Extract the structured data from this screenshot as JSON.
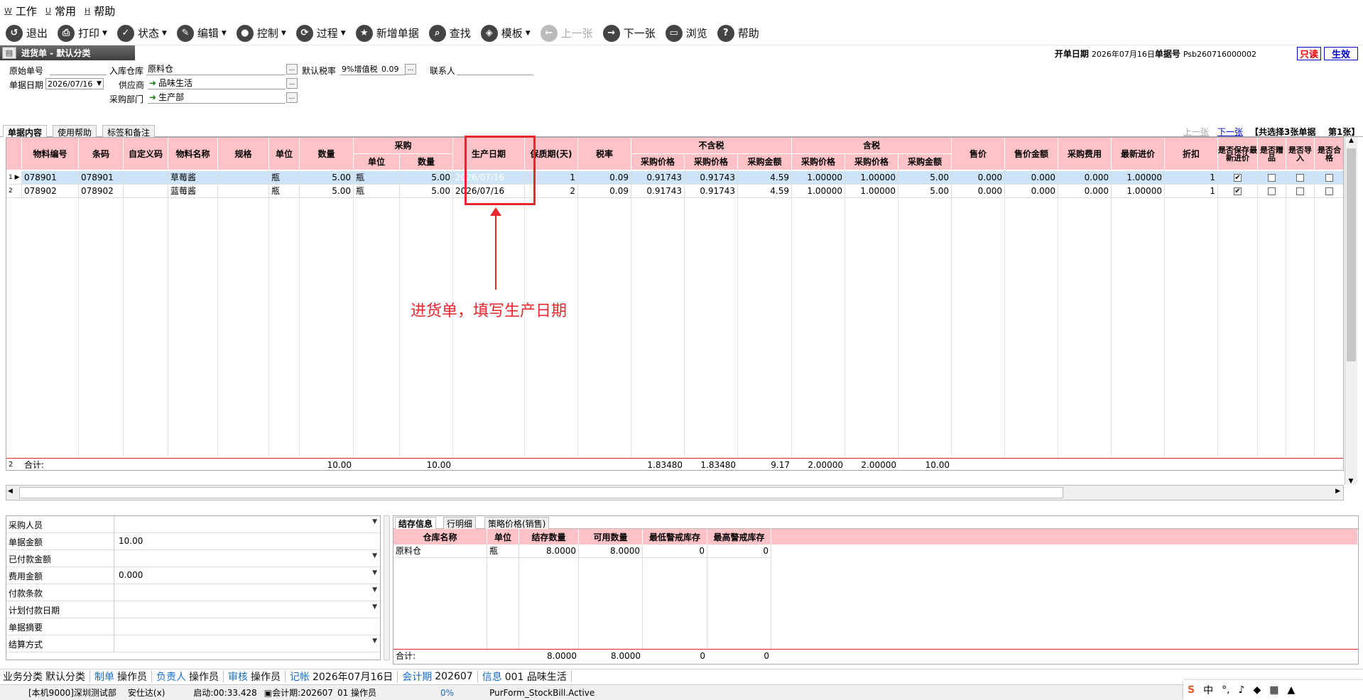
{
  "menu": [
    {
      "key": "W",
      "label": "工作"
    },
    {
      "key": "U",
      "label": "常用"
    },
    {
      "key": "H",
      "label": "帮助"
    }
  ],
  "toolbar": {
    "exit": "退出",
    "print": "打印",
    "status": "状态",
    "edit": "编辑",
    "control": "控制",
    "process": "过程",
    "new_bill": "新增单据",
    "find": "查找",
    "template": "模板",
    "prev": "上一张",
    "next": "下一张",
    "browse": "浏览",
    "help": "帮助"
  },
  "window": {
    "title": "进货单 - 默认分类",
    "open_date_label": "开单日期",
    "open_date": "2026年07月16日",
    "bill_no_label": "单据号",
    "bill_no": "Psb260716000002",
    "readonly_badge": "只读",
    "active_badge": "生效"
  },
  "header": {
    "orig_no_label": "原始单号",
    "orig_no": "",
    "warehouse_label": "入库仓库",
    "warehouse": "原料仓",
    "tax_label": "默认税率",
    "tax_value": "9%增值税",
    "tax_rate": "0.09",
    "contact_label": "联系人",
    "contact": "",
    "date_label": "单据日期",
    "date": "2026/07/16",
    "supplier_label": "供应商",
    "supplier": "品味生活",
    "dept_label": "采购部门",
    "dept": "生产部",
    "ellipsis": "..."
  },
  "tabs": {
    "content": "单据内容",
    "help": "使用帮助",
    "tags": "标签和备注"
  },
  "pager": {
    "prev": "上一张",
    "next": "下一张",
    "selected": "【共选择3张单据",
    "page": "第1张】"
  },
  "grid": {
    "headers": {
      "code": "物料编号",
      "barcode": "条码",
      "custom": "自定义码",
      "name": "物料名称",
      "spec": "规格",
      "unit": "单位",
      "qty": "数量",
      "purchase": "采购",
      "p_unit": "单位",
      "p_qty": "数量",
      "mfg": "生产日期",
      "shelf": "保质期(天)",
      "tax": "税率",
      "untaxed": "不含税",
      "ut_price1": "采购价格",
      "ut_price2": "采购价格",
      "ut_amount": "采购金额",
      "taxed": "含税",
      "t_price1": "采购价格",
      "t_price2": "采购价格",
      "t_amount": "采购金额",
      "sale": "售价",
      "sale_amt": "售价金额",
      "fee": "采购费用",
      "latest": "最新进价",
      "discount": "折扣",
      "keep_latest": "是否保存最新进价",
      "gift": "是否赠品",
      "imported": "是否导入",
      "contract": "是否合格"
    },
    "rows": [
      {
        "n": "1",
        "code": "078901",
        "barcode": "078901",
        "custom": "",
        "name": "草莓酱",
        "spec": "",
        "unit": "瓶",
        "qty": "5.00",
        "p_unit": "瓶",
        "p_qty": "5.00",
        "mfg": "2026/07/16",
        "shelf": "1",
        "tax": "0.09",
        "ut_price1": "0.91743",
        "ut_price2": "0.91743",
        "ut_amount": "4.59",
        "t_price1": "1.00000",
        "t_price2": "1.00000",
        "t_amount": "5.00",
        "sale": "0.000",
        "sale_amt": "0.000",
        "fee": "0.000",
        "latest": "1.00000",
        "discount": "1",
        "keep": "✔"
      },
      {
        "n": "2",
        "code": "078902",
        "barcode": "078902",
        "custom": "",
        "name": "蓝莓酱",
        "spec": "",
        "unit": "瓶",
        "qty": "5.00",
        "p_unit": "瓶",
        "p_qty": "5.00",
        "mfg": "2026/07/16",
        "shelf": "2",
        "tax": "0.09",
        "ut_price1": "0.91743",
        "ut_price2": "0.91743",
        "ut_amount": "4.59",
        "t_price1": "1.00000",
        "t_price2": "1.00000",
        "t_amount": "5.00",
        "sale": "0.000",
        "sale_amt": "0.000",
        "fee": "0.000",
        "latest": "1.00000",
        "discount": "1",
        "keep": "✔"
      }
    ],
    "total": {
      "count": "2",
      "label": "合计:",
      "qty": "10.00",
      "p_qty": "10.00",
      "ut_price1": "1.83480",
      "ut_price2": "1.83480",
      "ut_amount": "9.17",
      "t_price1": "2.00000",
      "t_price2": "2.00000",
      "t_amount": "10.00"
    }
  },
  "annotation": "进货单，填写生产日期",
  "form": [
    {
      "label": "采购人员",
      "value": "",
      "dd": true
    },
    {
      "label": "单据金额",
      "value": "10.00",
      "dd": false
    },
    {
      "label": "已付款金额",
      "value": "",
      "dd": true
    },
    {
      "label": "费用金额",
      "value": "0.000",
      "dd": true
    },
    {
      "label": "付款条款",
      "value": "",
      "dd": true
    },
    {
      "label": "计划付款日期",
      "value": "",
      "dd": true
    },
    {
      "label": "单据摘要",
      "value": "",
      "dd": false
    },
    {
      "label": "结算方式",
      "value": "",
      "dd": true
    }
  ],
  "stock": {
    "tabs": [
      "结存信息",
      "行明细",
      "策略价格(销售)"
    ],
    "headers": [
      "仓库名称",
      "单位",
      "结存数量",
      "可用数量",
      "最低警戒库存",
      "最高警戒库存"
    ],
    "row": [
      "原料仓",
      "瓶",
      "8.0000",
      "8.0000",
      "0",
      "0"
    ],
    "total": {
      "label": "合计:",
      "qty": "8.0000",
      "avail": "8.0000",
      "min": "0",
      "max": "0"
    }
  },
  "statusbar": [
    {
      "label": "业务分类",
      "value": "默认分类"
    },
    {
      "label": "制单",
      "value": "操作员"
    },
    {
      "label": "负责人",
      "value": "操作员"
    },
    {
      "label": "审核",
      "value": "操作员"
    },
    {
      "label": "记帐",
      "value": "2026年07月16日"
    },
    {
      "label": "会计期",
      "value": "202607"
    },
    {
      "label": "信息",
      "value": "001 品味生活"
    }
  ],
  "statusbar2": {
    "machine": "[本机9000]深圳测试部",
    "user": "安仕达(x)",
    "startup": "启动:00:33.428",
    "period": "会计期:202607",
    "operator": "01 操作员",
    "progress": "0%",
    "form": "PurForm_StockBill.Active"
  },
  "ime": {
    "mode": "中",
    "punct": "°,"
  }
}
